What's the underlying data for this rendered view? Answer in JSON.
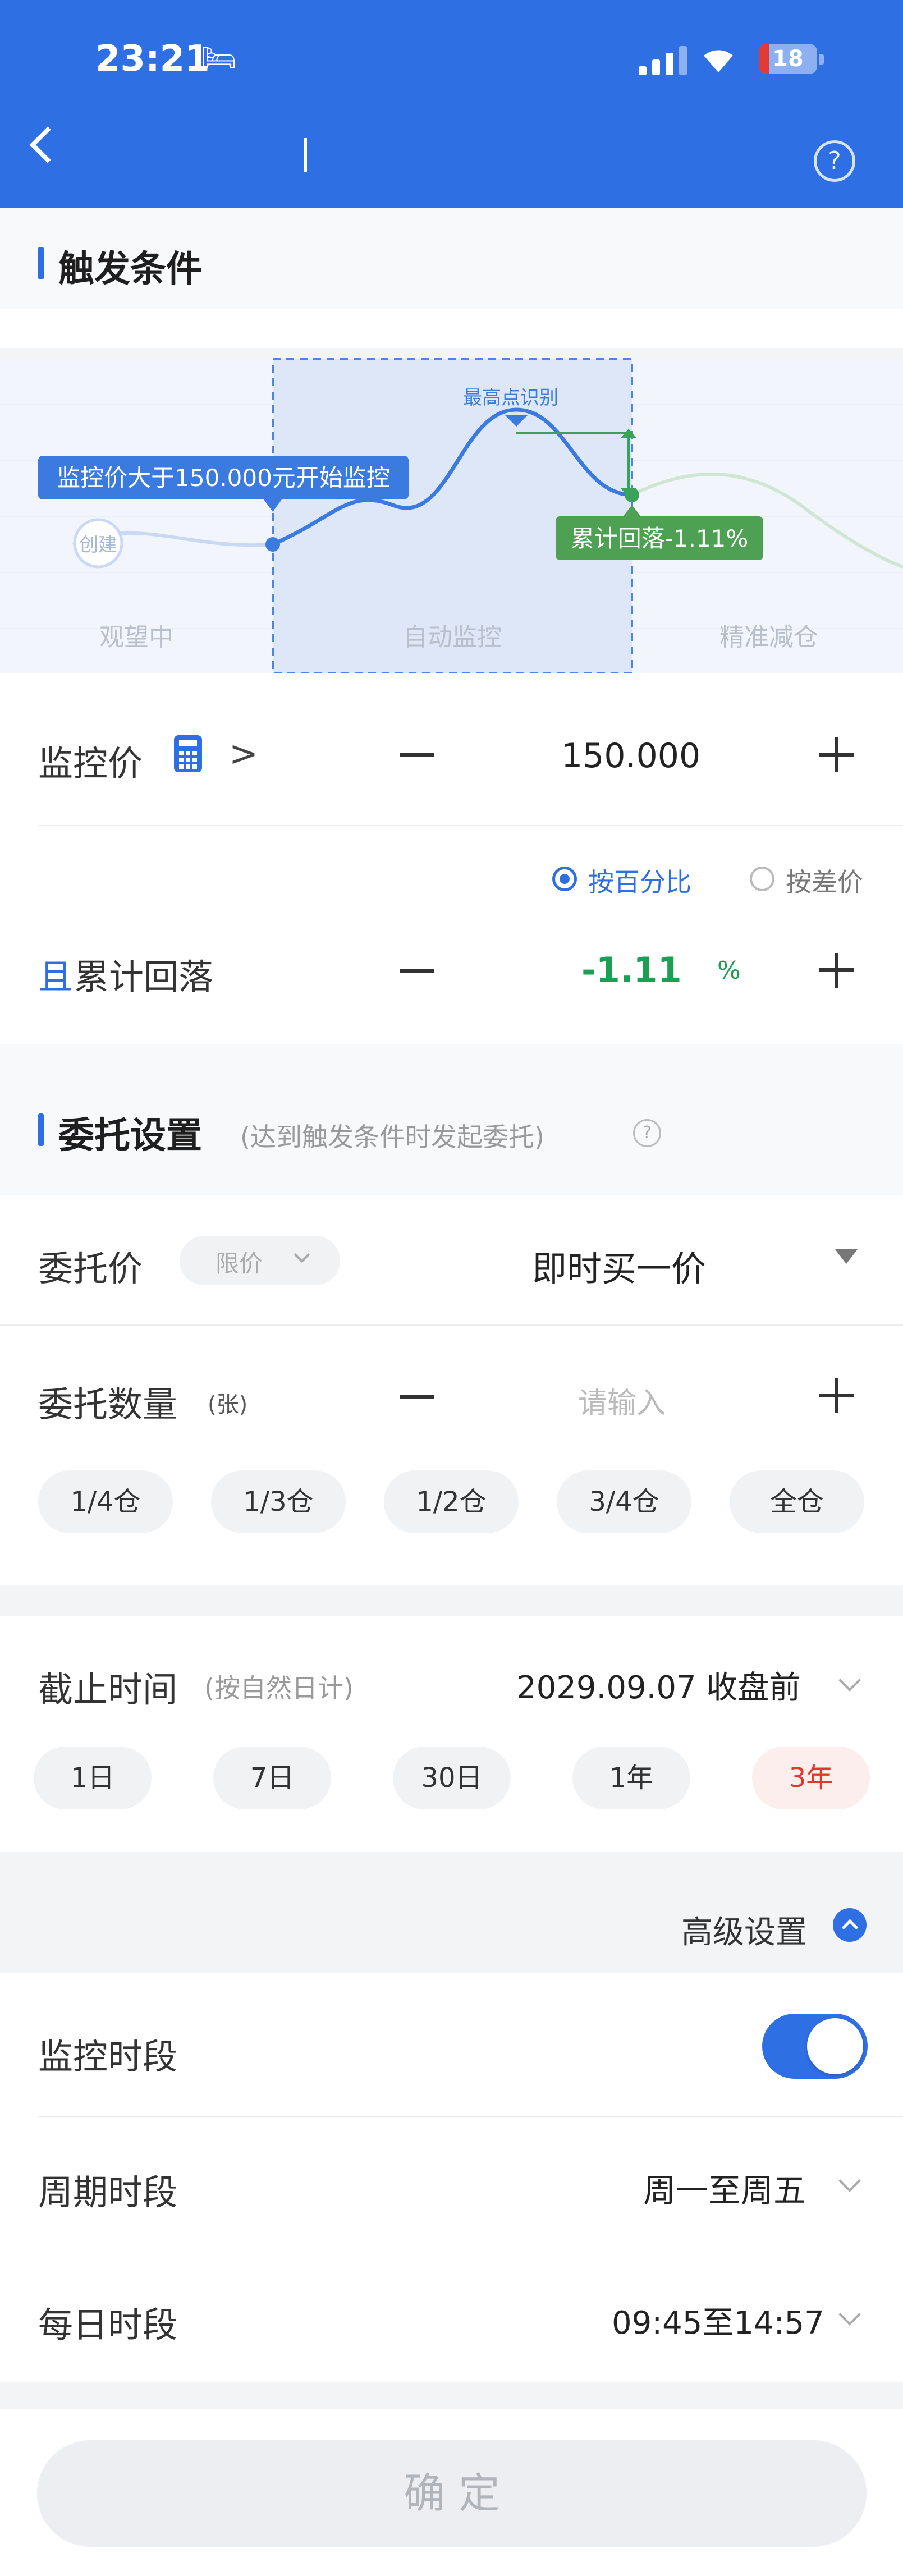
{
  "status_bar": {
    "time": "23:21",
    "battery": "18"
  },
  "trigger": {
    "title": "触发条件",
    "diagram": {
      "bubble_start": "监控价大于150.000元开始监控",
      "create_label": "创建",
      "peak_label": "最高点识别",
      "drawdown_bubble": "累计回落-1.11%",
      "phase_left": "观望中",
      "phase_mid": "自动监控",
      "phase_right": "精准减仓"
    },
    "monitor_price": {
      "label": "监控价",
      "operator": ">",
      "value": "150.000"
    },
    "mode_options": [
      "按百分比",
      "按差价"
    ],
    "mode_selected": "按百分比",
    "drawdown": {
      "prefix": "且",
      "label": "累计回落",
      "value": "-1.11",
      "unit": "%"
    }
  },
  "order": {
    "title": "委托设置",
    "subtitle": "(达到触发条件时发起委托)",
    "price": {
      "label": "委托价",
      "type": "限价",
      "value": "即时买一价"
    },
    "quantity": {
      "label": "委托数量",
      "unit": "(张)",
      "placeholder": "请输入"
    },
    "position_chips": [
      "1/4仓",
      "1/3仓",
      "1/2仓",
      "3/4仓",
      "全仓"
    ],
    "deadline": {
      "label": "截止时间",
      "hint": "(按自然日计)",
      "value": "2029.09.07 收盘前"
    },
    "period_chips": [
      "1日",
      "7日",
      "30日",
      "1年",
      "3年"
    ],
    "period_selected": "3年"
  },
  "advanced": {
    "toggle_label": "高级设置",
    "monitor_period": {
      "label": "监控时段",
      "enabled": true
    },
    "cycle": {
      "label": "周期时段",
      "value": "周一至周五"
    },
    "daily": {
      "label": "每日时段",
      "value": "09:45至14:57"
    }
  },
  "confirm_label": "确 定",
  "colors": {
    "primary": "#2f6fe4",
    "green": "#1e9e52",
    "red": "#e0392b"
  }
}
